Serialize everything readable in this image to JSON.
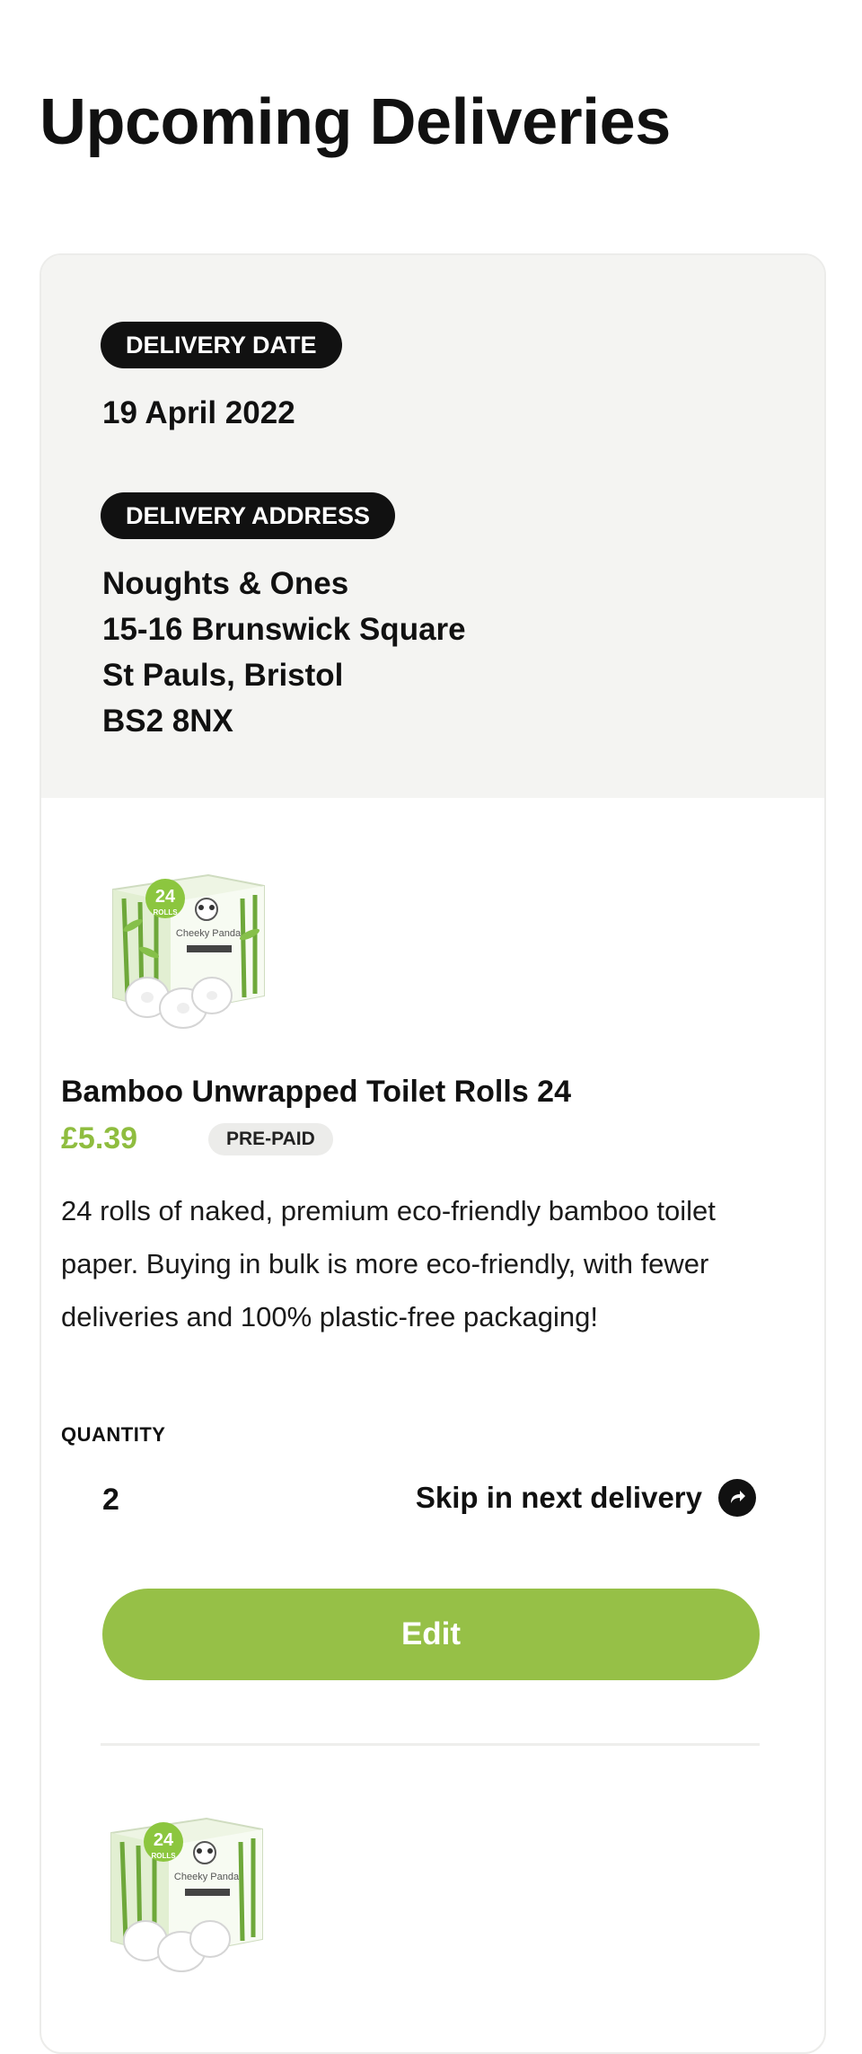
{
  "page": {
    "title": "Upcoming Deliveries"
  },
  "delivery": {
    "date_label": "DELIVERY DATE",
    "date_value": "19 April 2022",
    "address_label": "DELIVERY ADDRESS",
    "address_lines": [
      "Noughts & Ones",
      "15-16 Brunswick Square",
      "St Pauls, Bristol",
      "BS2 8NX"
    ]
  },
  "products": [
    {
      "image_text": {
        "count": "24",
        "unit": "ROLLS",
        "brand": "Cheeky Panda"
      },
      "name": "Bamboo Unwrapped Toilet Rolls 24",
      "price": "£5.39",
      "badge": "PRE-PAID",
      "description": "24 rolls of naked, premium eco-friendly bamboo toilet paper. Buying in bulk is more eco-friendly, with fewer deliveries and 100% plastic-free packaging!",
      "quantity_label": "QUANTITY",
      "quantity": "2",
      "skip_label": "Skip in next delivery",
      "edit_label": "Edit"
    },
    {
      "image_text": {
        "count": "24",
        "unit": "ROLLS",
        "brand": "Cheeky Panda"
      }
    }
  ],
  "colors": {
    "accent_green": "#96c047",
    "price_green": "#8fbd3f",
    "header_bg": "#f4f4f2",
    "pill_bg": "#111111"
  },
  "icons": {
    "skip": "redo-arrow-icon"
  }
}
